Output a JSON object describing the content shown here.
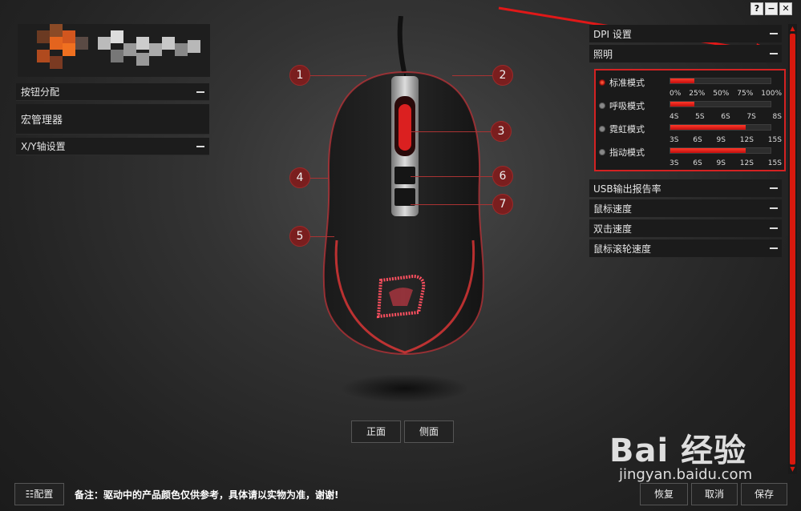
{
  "window": {
    "help": "?",
    "minimize": "−",
    "close": "✕"
  },
  "left_panel": {
    "button_assign": "按钮分配",
    "macro_manager": "宏管理器",
    "xy_axis": "X/Y轴设置"
  },
  "right_panel": {
    "dpi": "DPI 设置",
    "lighting": "照明",
    "modes": [
      {
        "label": "标准模式",
        "selected": true,
        "fill_percent": 24,
        "ticks": [
          "0%",
          "25%",
          "50%",
          "75%",
          "100%"
        ]
      },
      {
        "label": "呼吸模式",
        "selected": false,
        "fill_percent": 24,
        "ticks": [
          "4S",
          "5S",
          "6S",
          "7S",
          "8S"
        ]
      },
      {
        "label": "霓虹模式",
        "selected": false,
        "fill_percent": 75,
        "ticks": [
          "3S",
          "6S",
          "9S",
          "12S",
          "15S"
        ]
      },
      {
        "label": "指动模式",
        "selected": false,
        "fill_percent": 75,
        "ticks": [
          "3S",
          "6S",
          "9S",
          "12S",
          "15S"
        ]
      }
    ],
    "usb_rate": "USB输出报告率",
    "mouse_speed": "鼠标速度",
    "double_click": "双击速度",
    "scroll_speed": "鼠标滚轮速度"
  },
  "callouts": [
    "1",
    "2",
    "3",
    "4",
    "5",
    "6",
    "7"
  ],
  "view_buttons": {
    "front": "正面",
    "side": "侧面"
  },
  "bottom": {
    "config": "配置",
    "note": "备注：驱动中的产品颜色仅供参考，具体请以实物为准，谢谢!",
    "restore": "恢复",
    "cancel": "取消",
    "save": "保存"
  },
  "watermark": {
    "brand": "Bai 经验",
    "url": "jingyan.baidu.com"
  },
  "colors": {
    "accent": "#d8190e",
    "panel": "#1b1b1b",
    "highlight_border": "#d42222"
  }
}
